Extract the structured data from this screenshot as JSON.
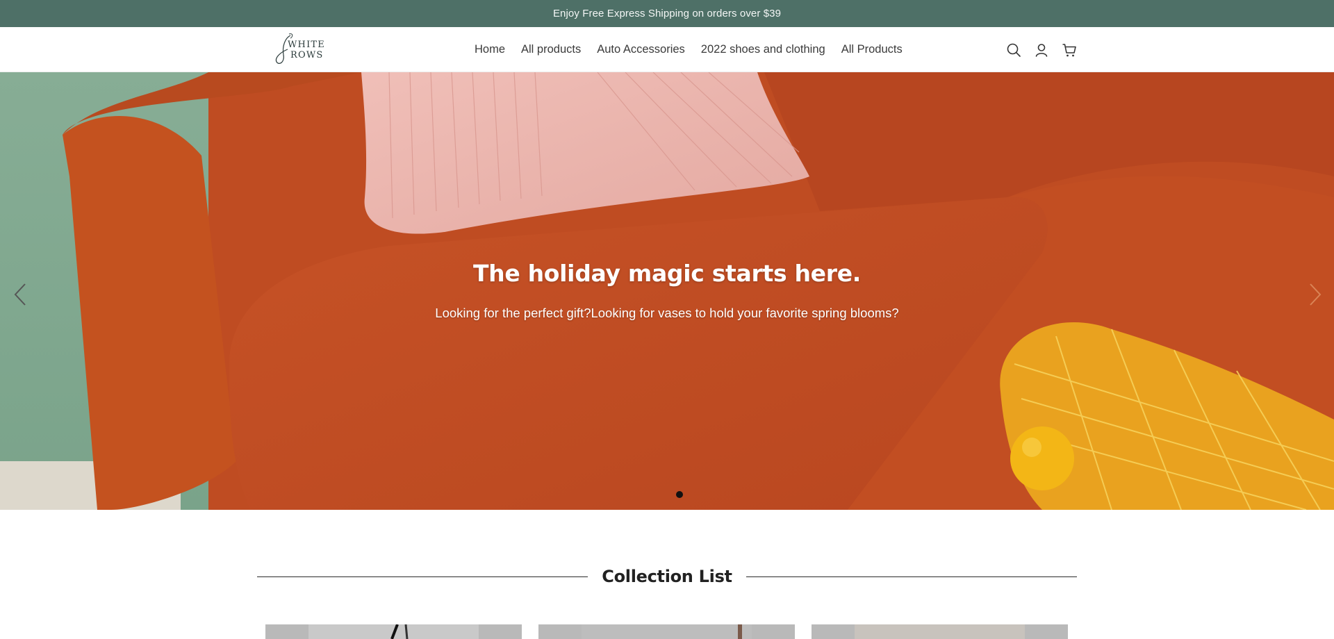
{
  "announcement": {
    "text": "Enjoy Free Express Shipping on orders over $39"
  },
  "brand": {
    "logo_line1": "WHITE",
    "logo_line2": "ROWS",
    "accent_color": "#4e7067"
  },
  "nav": {
    "items": [
      {
        "label": "Home"
      },
      {
        "label": "All products"
      },
      {
        "label": "Auto Accessories"
      },
      {
        "label": "2022 shoes and clothing"
      },
      {
        "label": "All Products"
      }
    ]
  },
  "header_icons": [
    "search-icon",
    "account-icon",
    "cart-icon"
  ],
  "hero": {
    "title": "The holiday magic starts here.",
    "subtitle": "Looking for the perfect gift?Looking for vases to hold your favorite spring blooms?",
    "slide_count": 2,
    "active_slide": 2,
    "prev_icon": "chevron-left-icon",
    "next_icon": "chevron-right-icon"
  },
  "collection": {
    "heading": "Collection List",
    "cards": [
      {
        "id": "card-1"
      },
      {
        "id": "card-2"
      },
      {
        "id": "card-3"
      }
    ]
  }
}
